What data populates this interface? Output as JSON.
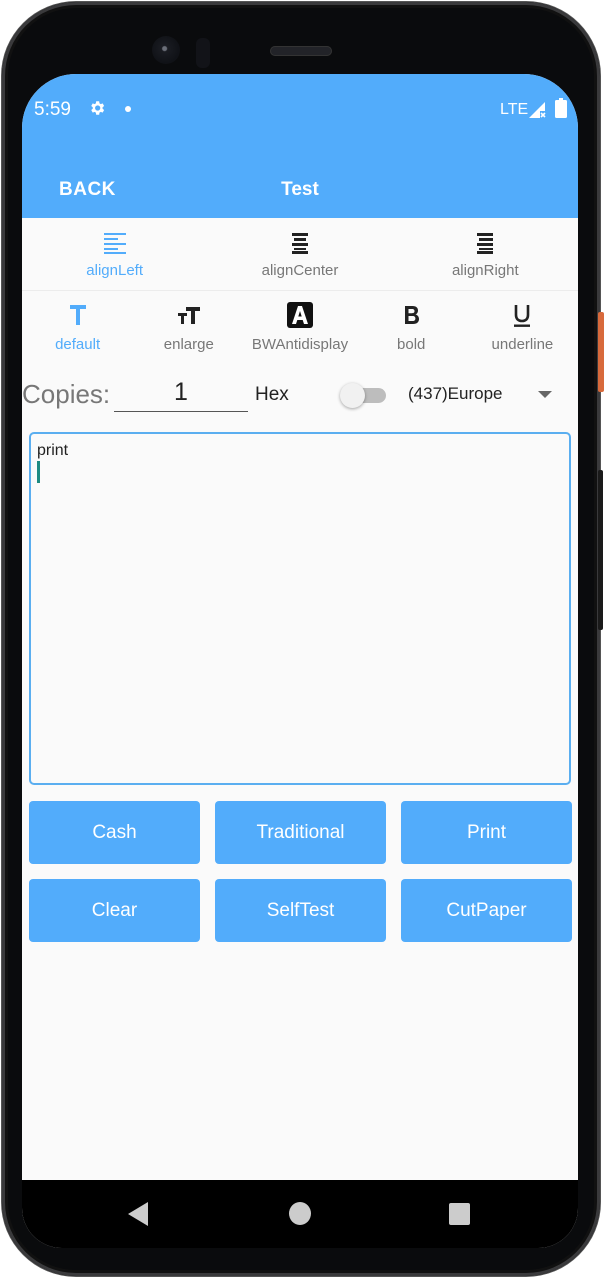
{
  "status_bar": {
    "time": "5:59",
    "network": "LTE",
    "icons": [
      "gear-icon",
      "notification-dot-icon",
      "signal-no-service-icon",
      "battery-icon"
    ]
  },
  "app_bar": {
    "back_label": "BACK",
    "title": "Test",
    "color": "#52acfb"
  },
  "alignment": {
    "items": [
      {
        "label": "alignLeft",
        "icon": "align-left-icon",
        "active": true
      },
      {
        "label": "alignCenter",
        "icon": "align-center-icon",
        "active": false
      },
      {
        "label": "alignRight",
        "icon": "align-right-icon",
        "active": false
      }
    ]
  },
  "text_style": {
    "items": [
      {
        "label": "default",
        "icon": "text-default-icon",
        "active": true
      },
      {
        "label": "enlarge",
        "icon": "text-enlarge-icon",
        "active": false
      },
      {
        "label": "BWAntidisplay",
        "icon": "inverse-a-icon",
        "active": false
      },
      {
        "label": "bold",
        "icon": "bold-icon",
        "active": false
      },
      {
        "label": "underline",
        "icon": "underline-icon",
        "active": false
      }
    ]
  },
  "options": {
    "copies_label": "Copies:",
    "copies_value": "1",
    "hex_label": "Hex",
    "hex_enabled": false,
    "codepage_selected": "(437)Europe"
  },
  "editor": {
    "value": "print"
  },
  "actions": [
    {
      "label": "Cash"
    },
    {
      "label": "Traditional"
    },
    {
      "label": "Print"
    },
    {
      "label": "Clear"
    },
    {
      "label": "SelfTest"
    },
    {
      "label": "CutPaper"
    }
  ],
  "colors": {
    "accent": "#52acfb",
    "inactive_text": "#777777",
    "background": "#fafafa"
  }
}
